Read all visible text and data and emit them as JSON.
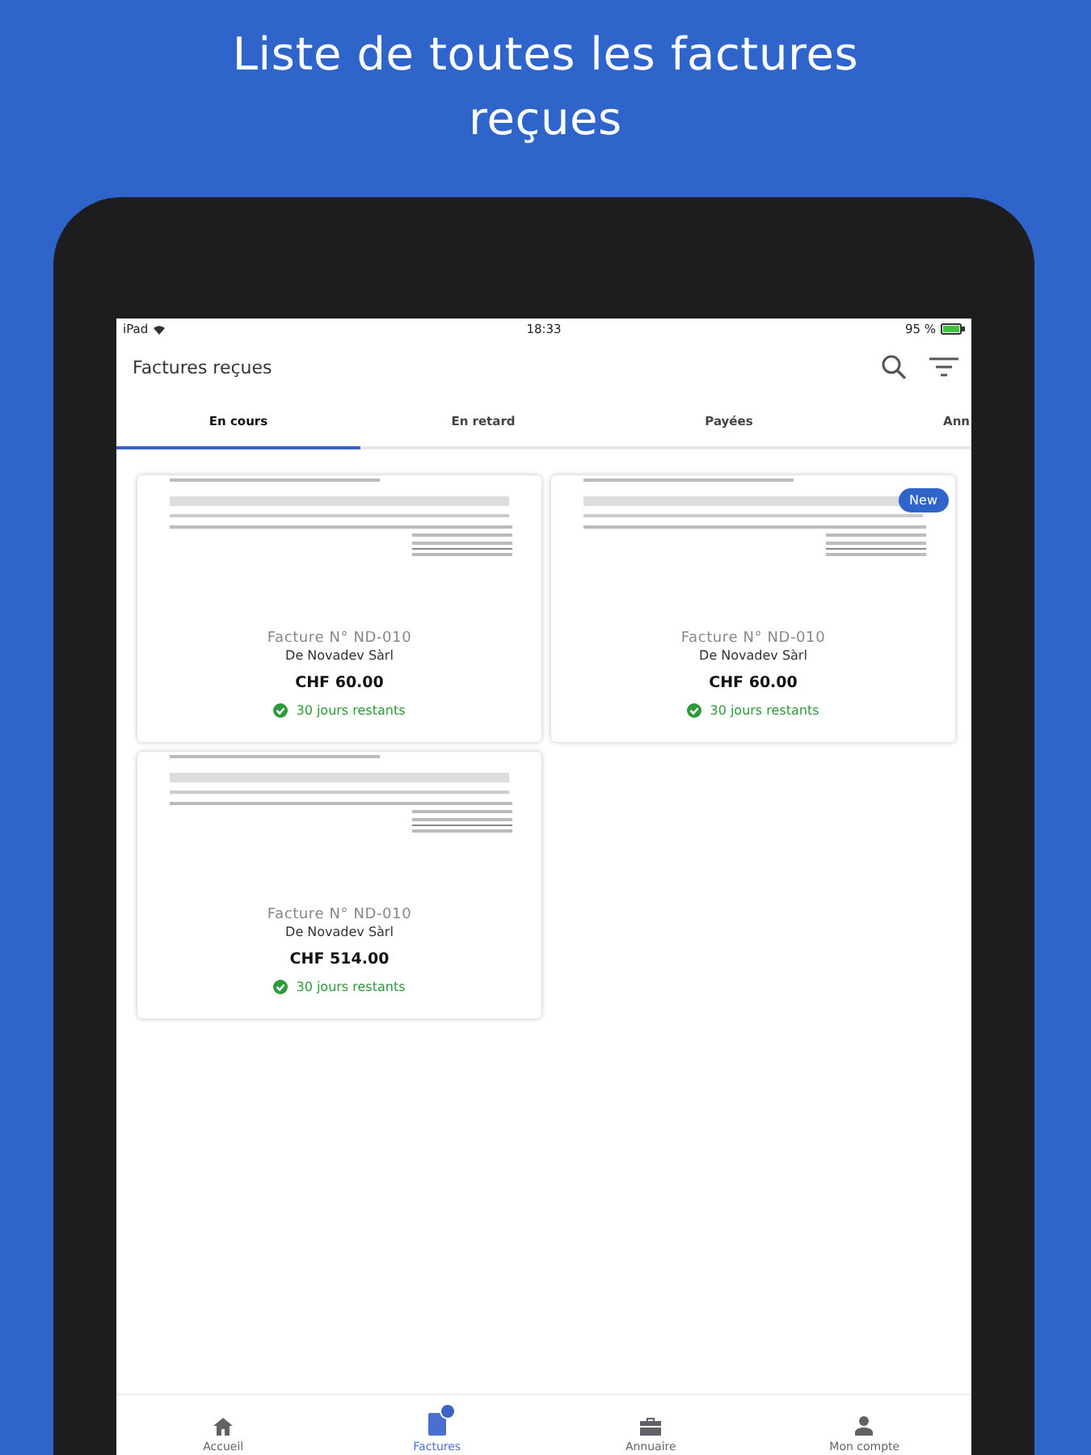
{
  "headline": "Liste de toutes les factures reçues",
  "status_bar": {
    "device": "iPad",
    "time": "18:33",
    "battery": "95 %"
  },
  "app_bar": {
    "title": "Factures reçues"
  },
  "tabs": [
    {
      "label": "En cours",
      "selected": true
    },
    {
      "label": "En retard",
      "selected": false
    },
    {
      "label": "Payées",
      "selected": false
    },
    {
      "label": "Ann",
      "selected": false
    }
  ],
  "invoices": [
    {
      "number": "Facture N° ND-010",
      "supplier": "De Novadev Sàrl",
      "amount": "CHF 60.00",
      "due": "30 jours restants",
      "new": false
    },
    {
      "number": "Facture N° ND-010",
      "supplier": "De Novadev Sàrl",
      "amount": "CHF 60.00",
      "due": "30 jours restants",
      "new": true,
      "new_label": "New"
    },
    {
      "number": "Facture N° ND-010",
      "supplier": "De Novadev Sàrl",
      "amount": "CHF 514.00",
      "due": "30 jours restants",
      "new": false
    }
  ],
  "bottom_nav": [
    {
      "kind": "home",
      "label": "Accueil",
      "selected": false,
      "badge": false
    },
    {
      "kind": "invoice",
      "label": "Factures",
      "selected": true,
      "badge": true
    },
    {
      "kind": "briefcase",
      "label": "Annuaire",
      "selected": false,
      "badge": false
    },
    {
      "kind": "person",
      "label": "Mon compte",
      "selected": false,
      "badge": false
    }
  ]
}
